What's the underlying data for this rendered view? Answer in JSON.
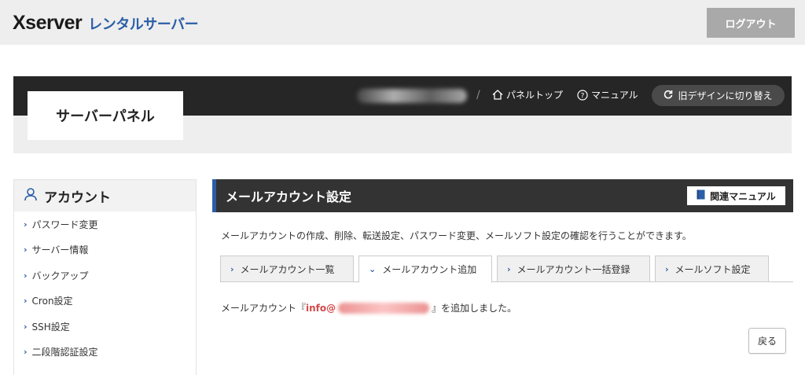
{
  "header": {
    "logo_main": "Xserver",
    "logo_sub": "レンタルサーバー",
    "logout_label": "ログアウト"
  },
  "panel": {
    "title": "サーバーパネル",
    "nav_panel_top": "パネルトップ",
    "nav_manual": "マニュアル",
    "old_design": "旧デザインに切り替え"
  },
  "sidebar": {
    "heading": "アカウント",
    "items": [
      {
        "label": "パスワード変更"
      },
      {
        "label": "サーバー情報"
      },
      {
        "label": "バックアップ"
      },
      {
        "label": "Cron設定"
      },
      {
        "label": "SSH設定"
      },
      {
        "label": "二段階認証設定"
      }
    ]
  },
  "main": {
    "title": "メールアカウント設定",
    "manual_button": "関連マニュアル",
    "description": "メールアカウントの作成、削除、転送設定、パスワード変更、メールソフト設定の確認を行うことができます。",
    "tabs": [
      {
        "label": "メールアカウント一覧",
        "active": false
      },
      {
        "label": "メールアカウント追加",
        "active": true
      },
      {
        "label": "メールアカウント一括登録",
        "active": false
      },
      {
        "label": "メールソフト設定",
        "active": false
      }
    ],
    "result_prefix": "メールアカウント『",
    "result_email_visible": "info@",
    "result_suffix": "』を追加しました。",
    "back_button": "戻る"
  },
  "colors": {
    "accent_blue": "#2b5ea7",
    "header_dark": "#262626",
    "email_red": "#d44a4a"
  }
}
